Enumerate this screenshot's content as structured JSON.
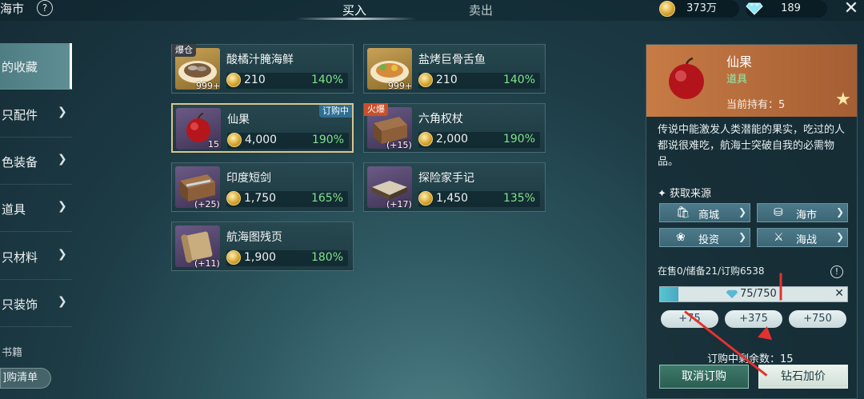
{
  "header": {
    "title": "海市",
    "help": "?",
    "tabs": [
      {
        "label": "买入"
      },
      {
        "label": "卖出"
      }
    ],
    "coins": "373万",
    "diamonds": "189",
    "close": "✕"
  },
  "sidebar": {
    "items": [
      {
        "label": "的收藏"
      },
      {
        "label": "只配件"
      },
      {
        "label": "色装备"
      },
      {
        "label": "道具"
      },
      {
        "label": "只材料"
      },
      {
        "label": "只装饰"
      },
      {
        "label": "书籍"
      }
    ],
    "buy_list": "订购清单",
    "buy_list_visible": "]购清单"
  },
  "items": [
    {
      "name": "酸橘汁腌海鲜",
      "price": "210",
      "pct": "140%",
      "badge": "爆仓",
      "qty": "999+"
    },
    {
      "name": "盐烤巨骨舌鱼",
      "price": "210",
      "pct": "140%",
      "badge": "",
      "qty": "999+"
    },
    {
      "name": "仙果",
      "price": "4,000",
      "pct": "190%",
      "badge": "订购中",
      "qty": "15"
    },
    {
      "name": "六角权杖",
      "price": "2,000",
      "pct": "190%",
      "badge": "火爆",
      "qty": "(+15)"
    },
    {
      "name": "印度短剑",
      "price": "1,750",
      "pct": "165%",
      "badge": "",
      "qty": "(+25)"
    },
    {
      "name": "探险家手记",
      "price": "1,450",
      "pct": "135%",
      "badge": "",
      "qty": "(+17)"
    },
    {
      "name": "航海图残页",
      "price": "1,900",
      "pct": "180%",
      "badge": "",
      "qty": "(+11)"
    }
  ],
  "detail": {
    "name": "仙果",
    "type": "道具",
    "holding": "当前持有：5",
    "desc": "传说中能激发人类潜能的果实，吃过的人都说很难吃，航海士突破自我的必需物品。",
    "source_title": "✦ 获取来源",
    "sources": [
      {
        "label": "商城"
      },
      {
        "label": "海市"
      },
      {
        "label": "投资"
      },
      {
        "label": "海战"
      }
    ],
    "stock": "在售0/储备21/订购6538",
    "bar_text": "75/750",
    "bar_progress": 0.1,
    "increments": [
      "+75",
      "+375",
      "+750"
    ],
    "remaining": "订购中剩余数：15",
    "cancel": "取消订购",
    "diamond_raise": "钻石加价"
  }
}
